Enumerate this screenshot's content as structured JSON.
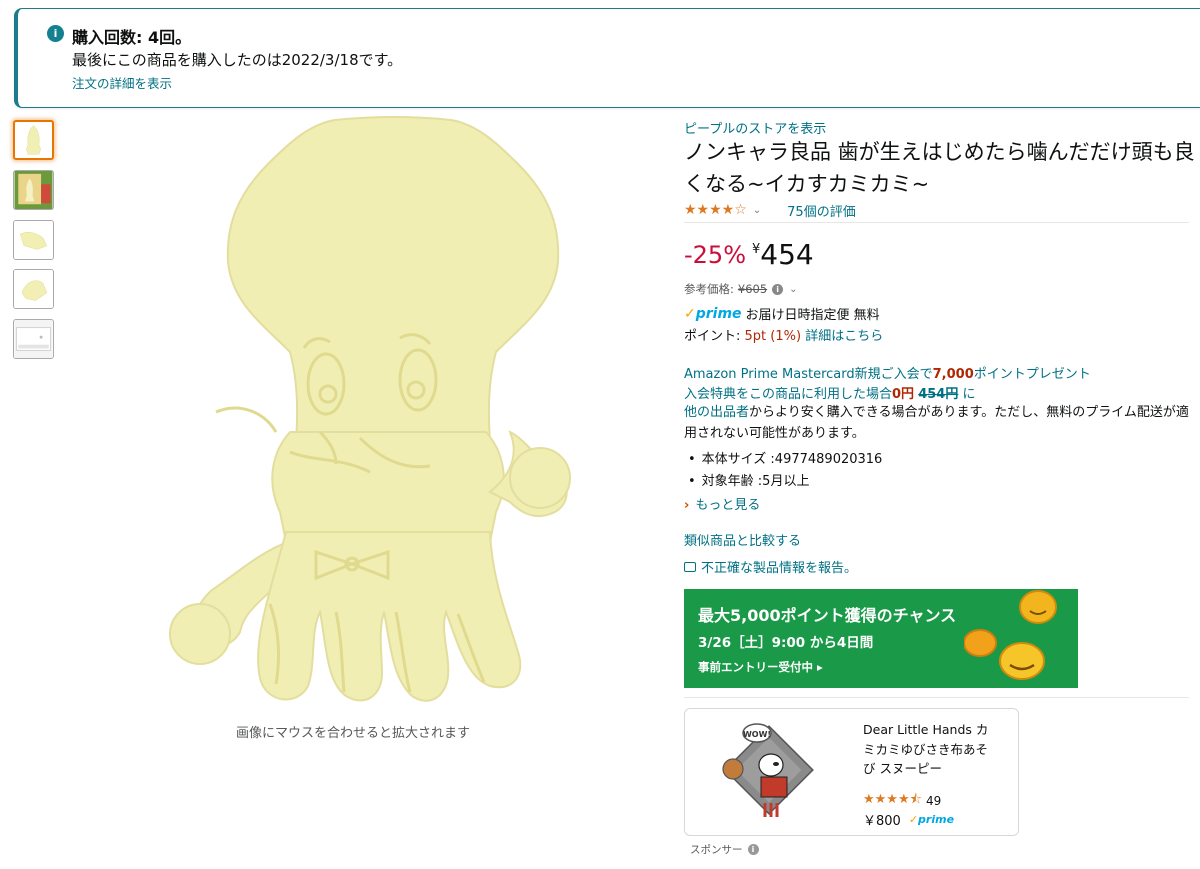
{
  "notice": {
    "icon": "info-icon",
    "title": "購入回数: 4回。",
    "detail": "最後にこの商品を購入したのは2022/3/18です。",
    "link": "注文の詳細を表示"
  },
  "gallery": {
    "thumbnails": [
      "product-front",
      "product-package",
      "product-side",
      "product-angle",
      "product-box"
    ],
    "active_index": 0,
    "hover_hint": "画像にマウスを合わせると拡大されます"
  },
  "product": {
    "store_link": "ピープルのストアを表示",
    "title": "ノンキャラ良品 歯が生えはじめたら噛んだだけ頭も良くなる~イカすカミカミ~",
    "rating_stars": 4,
    "rating_max": 5,
    "review_count": "75個の評価",
    "discount": "-25%",
    "currency": "¥",
    "price": "454",
    "reference_label": "参考価格:",
    "reference_price": "¥605",
    "prime_label": "prime",
    "delivery": "お届け日時指定便 無料",
    "points_label": "ポイント:",
    "points_value": "5pt",
    "points_percent": "(1%)",
    "points_link": "詳細はこちら"
  },
  "offer": {
    "mc_text": "Amazon Prime Mastercard新規ご入会で",
    "mc_points": "7,000",
    "mc_suffix": "ポイントプレゼント",
    "line2_prefix": "入会特典をこの商品に利用した場合",
    "line2_price": "0円",
    "line2_strike": "454円",
    "line2_suffix": "に",
    "other_link": "他の出品者",
    "other_text": "からより安く購入できる場合があります。ただし、無料のプライム配送が適用されない可能性があります。"
  },
  "specs": [
    "本体サイズ :4977489020316",
    "対象年齢 :5月以上"
  ],
  "links": {
    "more": "もっと見る",
    "compare": "類似商品と比較する",
    "report": "不正確な製品情報を報告。"
  },
  "banner": {
    "line1": "最大5,000ポイント獲得のチャンス",
    "line2": "3/26［土］9:00 から4日間",
    "line3": "事前エントリー受付中 ▸",
    "bg_color": "#1a9a48"
  },
  "ad": {
    "title": "Dear Little Hands カミカミゆびさき布あそび スヌーピー",
    "rating_stars": 4.5,
    "review_count": "49",
    "price": "￥800",
    "prime_label": "prime",
    "badge": "WOW!",
    "sponsored": "スポンサー"
  },
  "colors": {
    "link": "#007185",
    "discount": "#cc0c39",
    "star": "#de7921",
    "accent_border": "#1b7c8c"
  }
}
